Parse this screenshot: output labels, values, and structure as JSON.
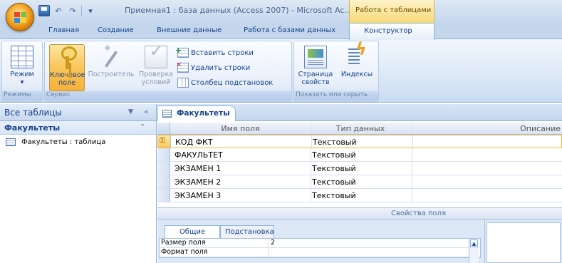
{
  "window": {
    "title": "Приемная1 : база данных (Access 2007) - Microsoft Ac...",
    "context_tab_group": "Работа с таблицами"
  },
  "quick_access": {
    "undo_label": "↶",
    "redo_label": "↷",
    "customize_label": "▾"
  },
  "ribbon": {
    "tabs": [
      "Главная",
      "Создание",
      "Внешние данные",
      "Работа с базами данных"
    ],
    "active_tab": "Конструктор",
    "groups": {
      "views": {
        "label": "Режимы",
        "buttons": {
          "mode": "Режим"
        }
      },
      "tools": {
        "label": "Сервис",
        "buttons": {
          "primary_key_1": "Ключевое",
          "primary_key_2": "поле",
          "builder": "Построитель",
          "validation_1": "Проверка",
          "validation_2": "условий",
          "insert_rows": "Вставить строки",
          "delete_rows": "Удалить строки",
          "lookup_column": "Столбец подстановок"
        }
      },
      "show_hide": {
        "label": "Показать или скрыть",
        "buttons": {
          "property_sheet_1": "Страница",
          "property_sheet_2": "свойств",
          "indexes": "Индексы"
        }
      }
    }
  },
  "nav_pane": {
    "header": "Все таблицы",
    "group": "Факультеты",
    "items": [
      {
        "label": "Факультеты : таблица"
      }
    ]
  },
  "document": {
    "tab": "Факультеты",
    "columns": [
      "Имя поля",
      "Тип данных",
      "Описание"
    ],
    "rows": [
      {
        "name": "КОД ФКТ",
        "type": "Текстовый",
        "desc": "",
        "key": true
      },
      {
        "name": "ФАКУЛЬТЕТ",
        "type": "Текстовый",
        "desc": ""
      },
      {
        "name": "ЭКЗАМЕН 1",
        "type": "Текстовый",
        "desc": ""
      },
      {
        "name": "ЭКЗАМЕН 2",
        "type": "Текстовый",
        "desc": ""
      },
      {
        "name": "ЭКЗАМЕН 3",
        "type": "Текстовый",
        "desc": ""
      }
    ],
    "field_properties": {
      "title": "Свойства поля",
      "tabs": [
        "Общие",
        "Подстановка"
      ],
      "rows": [
        {
          "label": "Размер поля",
          "value": "2"
        },
        {
          "label": "Формат поля",
          "value": ""
        }
      ]
    }
  }
}
